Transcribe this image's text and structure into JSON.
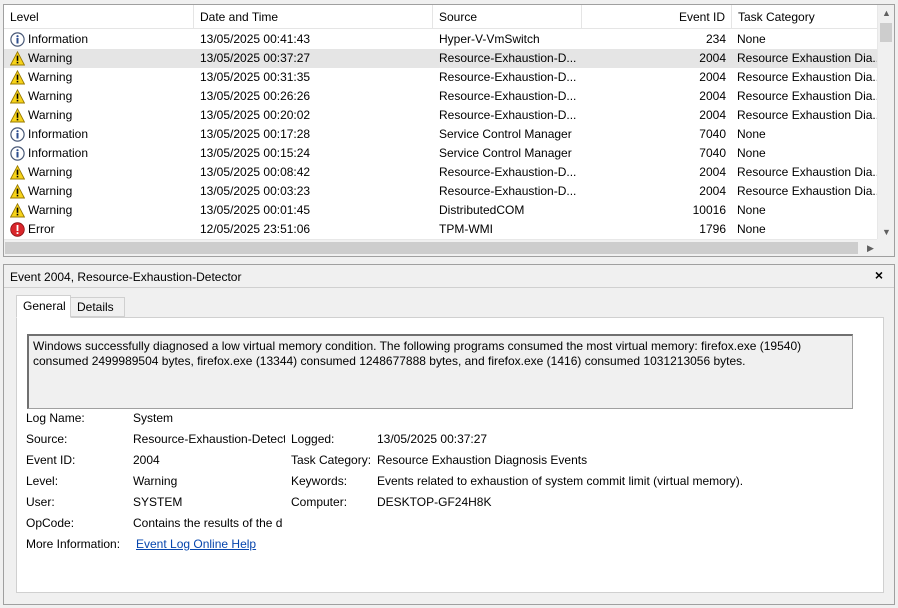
{
  "colors": {
    "selected_row": "#e5e5e5",
    "warning_yellow": "#f7d31a",
    "info_blue": "#3a6fcf",
    "error_red": "#d9262b",
    "link_blue": "#0645ad"
  },
  "list": {
    "columns": {
      "level": "Level",
      "date": "Date and Time",
      "source": "Source",
      "event_id": "Event ID",
      "task": "Task Category"
    },
    "rows": [
      {
        "level": "Information",
        "icon": "information-icon",
        "date": "13/05/2025 00:41:43",
        "source": "Hyper-V-VmSwitch",
        "event_id": "234",
        "task": "None",
        "selected": false
      },
      {
        "level": "Warning",
        "icon": "warning-icon",
        "date": "13/05/2025 00:37:27",
        "source": "Resource-Exhaustion-D...",
        "event_id": "2004",
        "task": "Resource Exhaustion Dia...",
        "selected": true
      },
      {
        "level": "Warning",
        "icon": "warning-icon",
        "date": "13/05/2025 00:31:35",
        "source": "Resource-Exhaustion-D...",
        "event_id": "2004",
        "task": "Resource Exhaustion Dia...",
        "selected": false
      },
      {
        "level": "Warning",
        "icon": "warning-icon",
        "date": "13/05/2025 00:26:26",
        "source": "Resource-Exhaustion-D...",
        "event_id": "2004",
        "task": "Resource Exhaustion Dia...",
        "selected": false
      },
      {
        "level": "Warning",
        "icon": "warning-icon",
        "date": "13/05/2025 00:20:02",
        "source": "Resource-Exhaustion-D...",
        "event_id": "2004",
        "task": "Resource Exhaustion Dia...",
        "selected": false
      },
      {
        "level": "Information",
        "icon": "information-icon",
        "date": "13/05/2025 00:17:28",
        "source": "Service Control Manager",
        "event_id": "7040",
        "task": "None",
        "selected": false
      },
      {
        "level": "Information",
        "icon": "information-icon",
        "date": "13/05/2025 00:15:24",
        "source": "Service Control Manager",
        "event_id": "7040",
        "task": "None",
        "selected": false
      },
      {
        "level": "Warning",
        "icon": "warning-icon",
        "date": "13/05/2025 00:08:42",
        "source": "Resource-Exhaustion-D...",
        "event_id": "2004",
        "task": "Resource Exhaustion Dia...",
        "selected": false
      },
      {
        "level": "Warning",
        "icon": "warning-icon",
        "date": "13/05/2025 00:03:23",
        "source": "Resource-Exhaustion-D...",
        "event_id": "2004",
        "task": "Resource Exhaustion Dia...",
        "selected": false
      },
      {
        "level": "Warning",
        "icon": "warning-icon",
        "date": "13/05/2025 00:01:45",
        "source": "DistributedCOM",
        "event_id": "10016",
        "task": "None",
        "selected": false
      },
      {
        "level": "Error",
        "icon": "error-icon",
        "date": "12/05/2025 23:51:06",
        "source": "TPM-WMI",
        "event_id": "1796",
        "task": "None",
        "selected": false
      }
    ]
  },
  "details": {
    "title": "Event 2004, Resource-Exhaustion-Detector",
    "close_glyph": "×",
    "tabs": {
      "general": "General",
      "details": "Details"
    },
    "message": "Windows successfully diagnosed a low virtual memory condition. The following programs consumed the most virtual memory: firefox.exe (19540) consumed 2499989504 bytes, firefox.exe (13344) consumed 1248677888 bytes, and firefox.exe (1416) consumed 1031213056 bytes.",
    "fields": {
      "log_name_label": "Log Name:",
      "log_name": "System",
      "source_label": "Source:",
      "source": "Resource-Exhaustion-Detect",
      "logged_label": "Logged:",
      "logged": "13/05/2025 00:37:27",
      "event_id_label": "Event ID:",
      "event_id": "2004",
      "task_category_label": "Task Category:",
      "task_category": "Resource Exhaustion Diagnosis Events",
      "level_label": "Level:",
      "level": "Warning",
      "keywords_label": "Keywords:",
      "keywords": "Events related to exhaustion of system commit limit (virtual memory).",
      "user_label": "User:",
      "user": "SYSTEM",
      "computer_label": "Computer:",
      "computer": "DESKTOP-GF24H8K",
      "opcode_label": "OpCode:",
      "opcode": "Contains the results of the d",
      "more_info_label": "More Information:",
      "more_info_link": "Event Log Online Help"
    }
  }
}
